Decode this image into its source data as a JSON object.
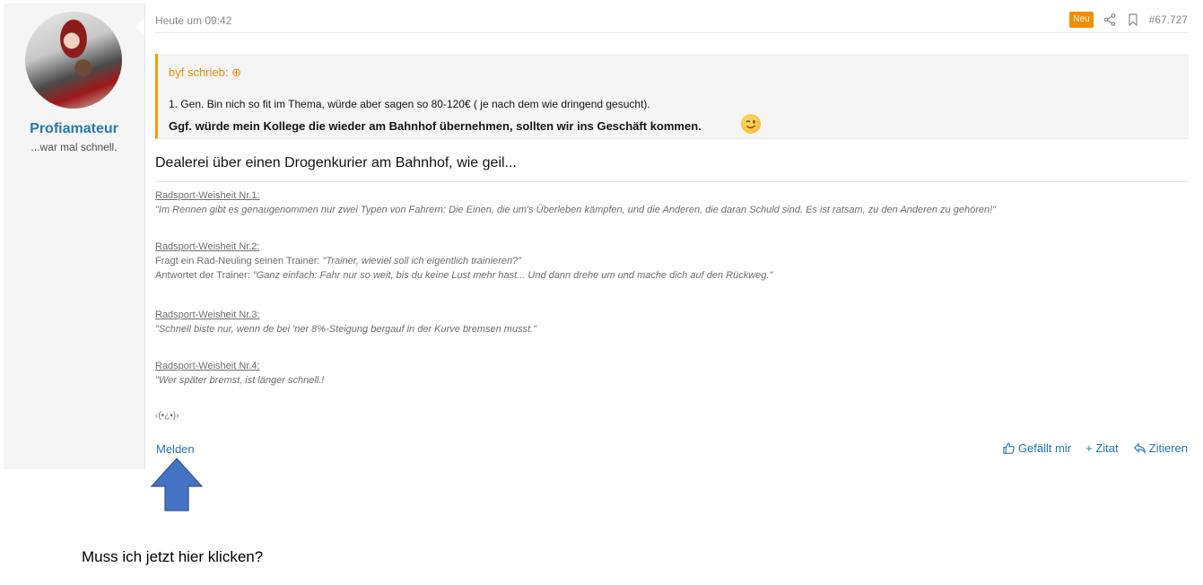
{
  "user": {
    "name": "Profiamateur",
    "title": "...war mal schnell."
  },
  "post": {
    "timestamp": "Heute um 09:42",
    "badge": "Neu",
    "number": "#67.727",
    "quote": {
      "author": "byf schrieb: ⊕",
      "line1": "1. Gen. Bin nich so fit im Thema, würde aber sagen so 80-120€ ( je nach dem wie dringend gesucht).",
      "line2": "Ggf. würde mein Kollege die wieder am Bahnhof übernehmen, sollten wir ins Geschäft kommen."
    },
    "message": "Dealerei über einen Drogenkurier am Bahnhof, wie geil...",
    "signature": {
      "w1_title": "Radsport-Weisheit Nr.1:",
      "w1_text": "\"Im Rennen gibt es genaugenommen nur zwei Typen von Fahrern: Die Einen, die um's Überleben kämpfen, und die Anderen, die daran Schuld sind. Es ist ratsam, zu den Anderen zu gehören!\"",
      "w2_title": "Radsport-Weisheit Nr.2:",
      "w2_line1_prefix": "Fragt ein Rad-Neuling seinen Trainer: ",
      "w2_line1_quote": "\"Trainer, wieviel soll ich eigentlich trainieren?\"",
      "w2_line2_prefix": "Antwortet der Trainer: ",
      "w2_line2_quote": "\"Ganz einfach: Fahr nur so weit, bis du keine Lust mehr hast... Und dann drehe um und mache dich auf den Rückweg.\"",
      "w3_title": "Radsport-Weisheit Nr.3:",
      "w3_text": "\"Schnell biste nur, wenn de bei 'ner 8%-Steigung bergauf in der Kurve bremsen musst.\"",
      "w4_title": "Radsport-Weisheit Nr.4:",
      "w4_text": "\"Wer später bremst, ist länger schnell.!",
      "smiley": "‹(•¿•)›"
    },
    "report_label": "Melden",
    "like_label": "Gefällt mir",
    "plus_quote_label": "+ Zitat",
    "reply_label": "Zitieren"
  },
  "annotation": {
    "question": "Muss ich jetzt hier klicken?",
    "arrow_color": "#4472c4"
  },
  "colors": {
    "accent": "#2577b1",
    "quote_border": "#f29c11",
    "badge": "#f28c00"
  }
}
